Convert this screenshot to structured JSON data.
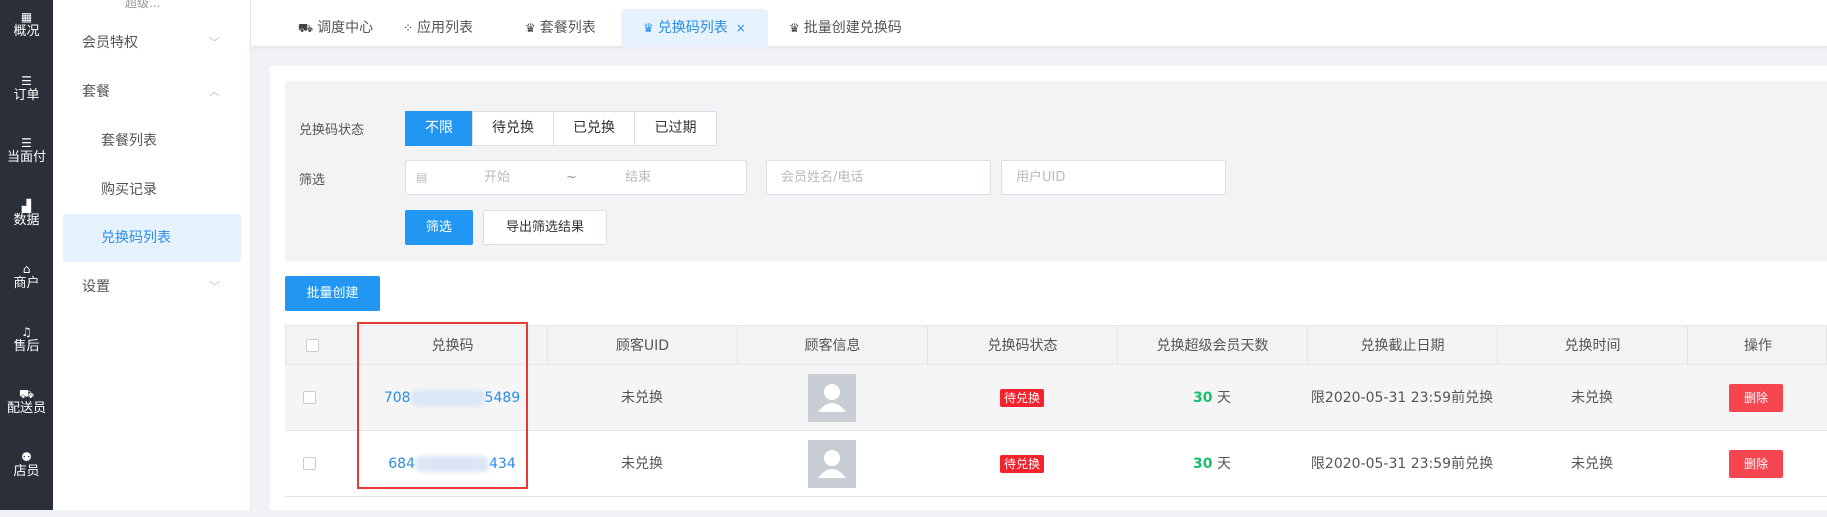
{
  "leftbar": {
    "items": [
      {
        "icon": "overview-icon",
        "glyph": "▦",
        "label": "概况"
      },
      {
        "icon": "order-icon",
        "glyph": "☰",
        "label": "订单"
      },
      {
        "icon": "pay-icon",
        "glyph": "☰",
        "label": "当面付"
      },
      {
        "icon": "data-icon",
        "glyph": "▟",
        "label": "数据"
      },
      {
        "icon": "store-icon",
        "glyph": "⌂",
        "label": "商户"
      },
      {
        "icon": "headset-icon",
        "glyph": "♫",
        "label": "售后"
      },
      {
        "icon": "delivery-icon",
        "glyph": "⛟",
        "label": "配送员"
      },
      {
        "icon": "staff-icon",
        "glyph": "⚉",
        "label": "店员"
      }
    ]
  },
  "submenu": {
    "top_partial": "超级...",
    "items": [
      {
        "label": "会员特权",
        "chevron": "﹀"
      },
      {
        "label": "套餐",
        "chevron": "︿"
      },
      {
        "label": "套餐列表"
      },
      {
        "label": "购买记录"
      },
      {
        "label": "兑换码列表"
      },
      {
        "label": "设置",
        "chevron": "﹀"
      }
    ]
  },
  "tabs": [
    {
      "icon": "dispatch-icon",
      "glyph": "⛟",
      "label": "调度中心"
    },
    {
      "icon": "apps-icon",
      "glyph": "⁘",
      "label": "应用列表"
    },
    {
      "icon": "crown-icon",
      "glyph": "♛",
      "label": "套餐列表"
    },
    {
      "icon": "crown-icon",
      "glyph": "♛",
      "label": "兑换码列表",
      "close": "×"
    },
    {
      "icon": "crown-icon",
      "glyph": "♛",
      "label": "批量创建兑换码"
    }
  ],
  "filter": {
    "status_label": "兑换码状态",
    "status_options": [
      "不限",
      "待兑换",
      "已兑换",
      "已过期"
    ],
    "filter_label": "筛选",
    "date_start_placeholder": "开始",
    "date_sep": "~",
    "date_end_placeholder": "结束",
    "member_placeholder": "会员姓名/电话",
    "uid_placeholder": "用户UID",
    "filter_button": "筛选",
    "export_button": "导出筛选结果"
  },
  "batch_create_button": "批量创建",
  "table": {
    "headers": [
      "兑换码",
      "顾客UID",
      "顾客信息",
      "兑换码状态",
      "兑换超级会员天数",
      "兑换截止日期",
      "兑换时间",
      "操作"
    ],
    "rows": [
      {
        "code_prefix": "708",
        "code_suffix": "5489",
        "uid": "未兑换",
        "status": "待兑换",
        "days": "30",
        "days_unit": "天",
        "deadline": "限2020-05-31 23:59前兑换",
        "redeem_time": "未兑换",
        "action": "删除"
      },
      {
        "code_prefix": "684",
        "code_suffix": "434",
        "uid": "未兑换",
        "status": "待兑换",
        "days": "30",
        "days_unit": "天",
        "deadline": "限2020-05-31 23:59前兑换",
        "redeem_time": "未兑换",
        "action": "删除"
      }
    ]
  },
  "colors": {
    "primary": "#2196f3",
    "danger": "#f5454e",
    "success": "#19be6b",
    "highlight": "#e53935"
  }
}
